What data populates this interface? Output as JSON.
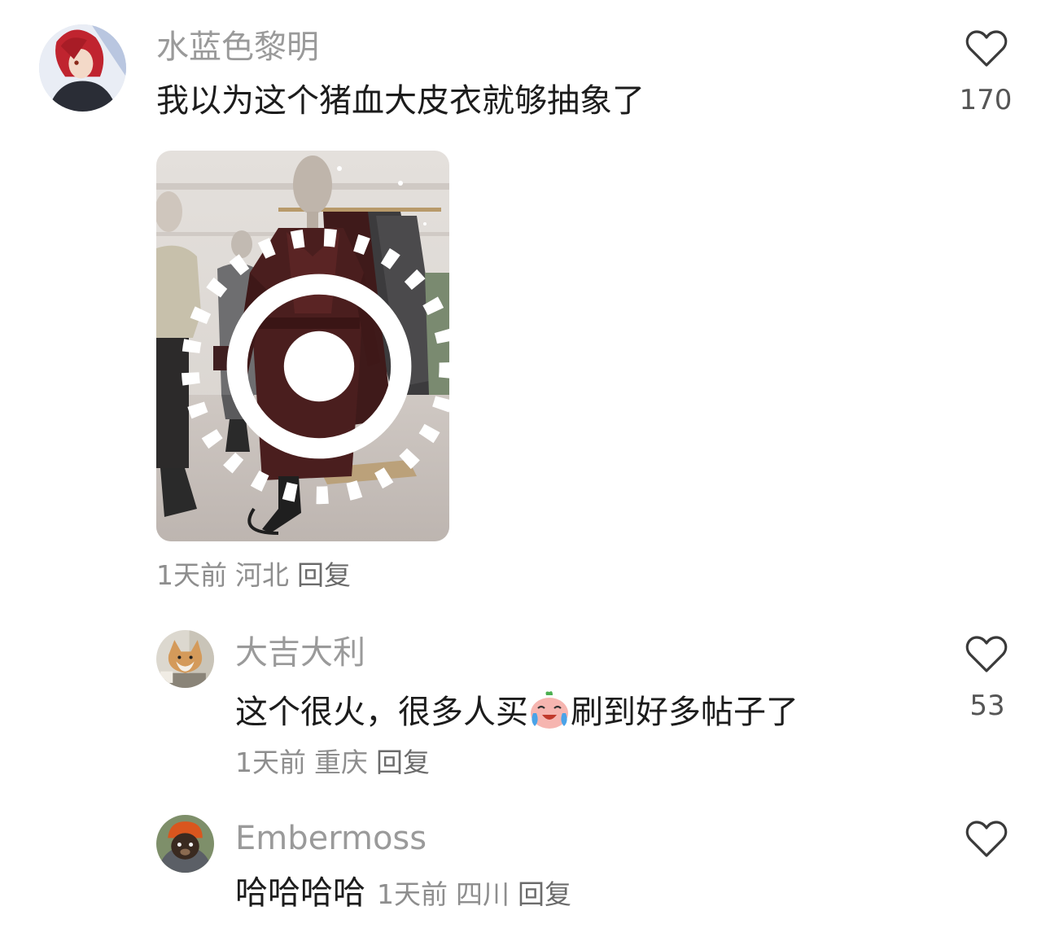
{
  "comments": [
    {
      "username": "水蓝色黎明",
      "text": "我以为这个猪血大皮衣就够抽象了",
      "time": "1天前",
      "location": "河北",
      "reply_label": "回复",
      "likes": "170",
      "image": {
        "badge_icon": "live-photo-icon"
      }
    },
    {
      "username": "大吉大利",
      "text_before": "这个很火，很多人买",
      "emoji": "crying-laughing-emoji-icon",
      "text_after": "刷到好多帖子了",
      "time": "1天前",
      "location": "重庆",
      "reply_label": "回复",
      "likes": "53"
    },
    {
      "username": "Embermoss",
      "text": "哈哈哈哈",
      "time": "1天前",
      "location": "四川",
      "reply_label": "回复",
      "likes": ""
    }
  ],
  "colors": {
    "username": "#9a9a9a",
    "meta": "#8e8e8e",
    "text": "#1c1c1c",
    "icon": "#3a3a3a"
  }
}
